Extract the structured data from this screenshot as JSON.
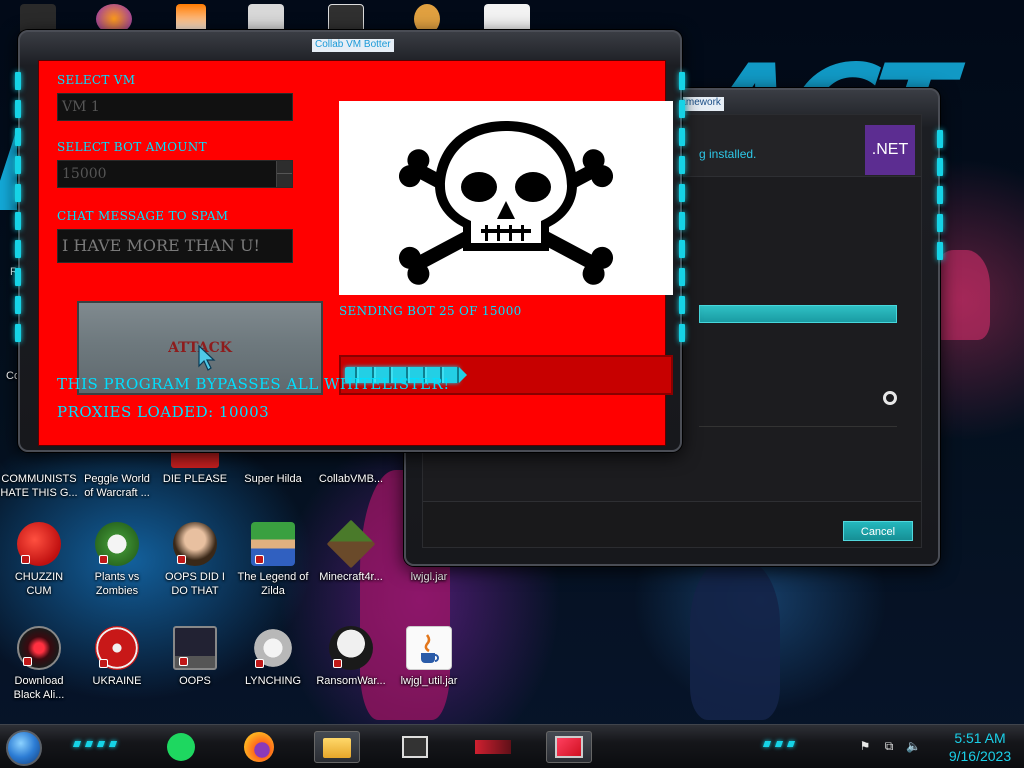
{
  "botter": {
    "window_title": "Collab VM Botter",
    "select_vm_label": "SELECT VM",
    "select_vm_value": "VM 1",
    "bot_amount_label": "SELECT BOT AMOUNT",
    "bot_amount_value": "15000",
    "chat_label": "CHAT MESSAGE TO SPAM",
    "chat_value": "I HAVE MORE THAN U!",
    "attack_label": "ATTACK",
    "status_text": "SENDING BOT 25 OF 15000",
    "bots_sent": 25,
    "bots_total": 15000,
    "progress_fraction": 0.36,
    "bypass_text": "THIS PROGRAM BYPASSES ALL WHITELISTER!",
    "proxies_text": "PROXIES LOADED: 10003",
    "background_color": "#ff0000",
    "accent_color": "#00dfff"
  },
  "installer": {
    "title_partial": "ramework",
    "message_partial": "g installed.",
    "logo_text": ".NET",
    "cancel_label": "Cancel",
    "logo_color": "#5c2d91"
  },
  "desktop_icons": [
    {
      "line1": "COMMUNISTS",
      "line2": "HATE THIS G...",
      "icon": "red-mascot-icon"
    },
    {
      "line1": "Peggle World",
      "line2": "of Warcraft ...",
      "icon": "peggle-icon"
    },
    {
      "line1": "DIE PLEASE",
      "line2": "",
      "icon": "red-app-icon"
    },
    {
      "line1": "Super Hilda",
      "line2": "",
      "icon": "pixel-game-icon"
    },
    {
      "line1": "CollabVMB...",
      "line2": "",
      "icon": "collabvm-icon"
    },
    {
      "line1": "CHUZZIN",
      "line2": "CUM",
      "icon": "chuzzle-icon"
    },
    {
      "line1": "Plants vs",
      "line2": "Zombies",
      "icon": "plants-vs-zombies-icon"
    },
    {
      "line1": "OOPS DID I",
      "line2": "DO THAT",
      "icon": "portrait-icon"
    },
    {
      "line1": "The Legend of",
      "line2": "Zilda",
      "icon": "zelda-icon"
    },
    {
      "line1": "Minecraft4r...",
      "line2": "",
      "icon": "minecraft-icon"
    },
    {
      "line1": "lwjgl.jar",
      "line2": "",
      "icon": "jar-icon"
    },
    {
      "line1": "Download",
      "line2": "Black Ali...",
      "icon": "eye-orb-icon"
    },
    {
      "line1": "UKRAINE",
      "line2": "",
      "icon": "radiation-icon"
    },
    {
      "line1": "OOPS",
      "line2": "",
      "icon": "monitor-icon"
    },
    {
      "line1": "LYNCHING",
      "line2": "",
      "icon": "ornament-icon"
    },
    {
      "line1": "RansomWar...",
      "line2": "",
      "icon": "skull-icon"
    },
    {
      "line1": "lwjgl_util.jar",
      "line2": "",
      "icon": "java-icon"
    }
  ],
  "partial_labels": {
    "left_re": "Re",
    "left_co": "Co"
  },
  "taskbar": {
    "apps": [
      "spotify-icon",
      "firefox-icon",
      "file-explorer-icon",
      "network-manager-icon",
      "cpu-monitor-icon",
      "monitor-app-icon"
    ],
    "time": "5:51 AM",
    "date": "9/16/2023"
  }
}
